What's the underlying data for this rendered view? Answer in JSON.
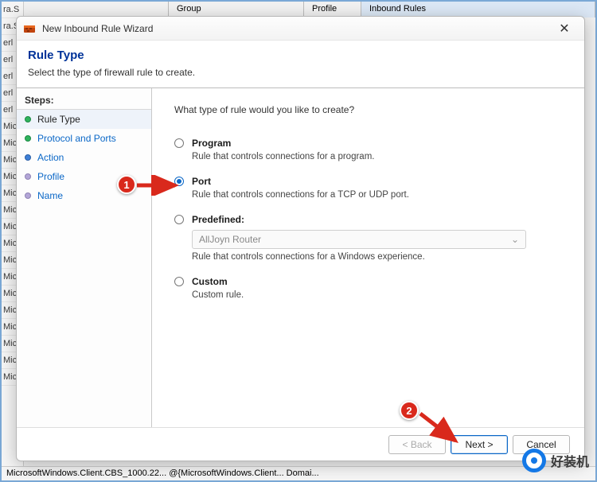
{
  "background": {
    "header": {
      "col1": "Group",
      "col2": "Profile",
      "col3": "Inbound Rules"
    },
    "rows_left": [
      "ra.S",
      "ra.S",
      "erl",
      "erl",
      "erl",
      "erl",
      "erl",
      "Mic",
      "Mic",
      "Mic",
      "Mic",
      "Mic",
      "Mic",
      "Mic",
      "Mic",
      "Mic",
      "Mic",
      "Mic",
      "Mic",
      "Mic",
      "Mic",
      "Mic",
      "Mic"
    ],
    "footer": "MicrosoftWindows.Client.CBS_1000.22...   @{MicrosoftWindows.Client...   Domai..."
  },
  "dialog": {
    "title": "New Inbound Rule Wizard",
    "header_title": "Rule Type",
    "header_subtitle": "Select the type of firewall rule to create.",
    "sidebar_title": "Steps:",
    "steps": [
      {
        "label": "Rule Type",
        "active": true,
        "link": false,
        "bullet": "green"
      },
      {
        "label": "Protocol and Ports",
        "active": false,
        "link": true,
        "bullet": "green"
      },
      {
        "label": "Action",
        "active": false,
        "link": true,
        "bullet": "blue"
      },
      {
        "label": "Profile",
        "active": false,
        "link": true,
        "bullet": "gray"
      },
      {
        "label": "Name",
        "active": false,
        "link": true,
        "bullet": "gray"
      }
    ],
    "main_prompt": "What type of rule would you like to create?",
    "options": {
      "program": {
        "label": "Program",
        "desc": "Rule that controls connections for a program."
      },
      "port": {
        "label": "Port",
        "desc": "Rule that controls connections for a TCP or UDP port."
      },
      "predefined": {
        "label": "Predefined:",
        "desc": "Rule that controls connections for a Windows experience.",
        "dropdown_value": "AllJoyn Router"
      },
      "custom": {
        "label": "Custom",
        "desc": "Custom rule."
      }
    },
    "selected_option": "port",
    "buttons": {
      "back": "< Back",
      "next": "Next >",
      "cancel": "Cancel"
    }
  },
  "annotations": {
    "badge1": "1",
    "badge2": "2"
  },
  "watermark_text": "好装机"
}
